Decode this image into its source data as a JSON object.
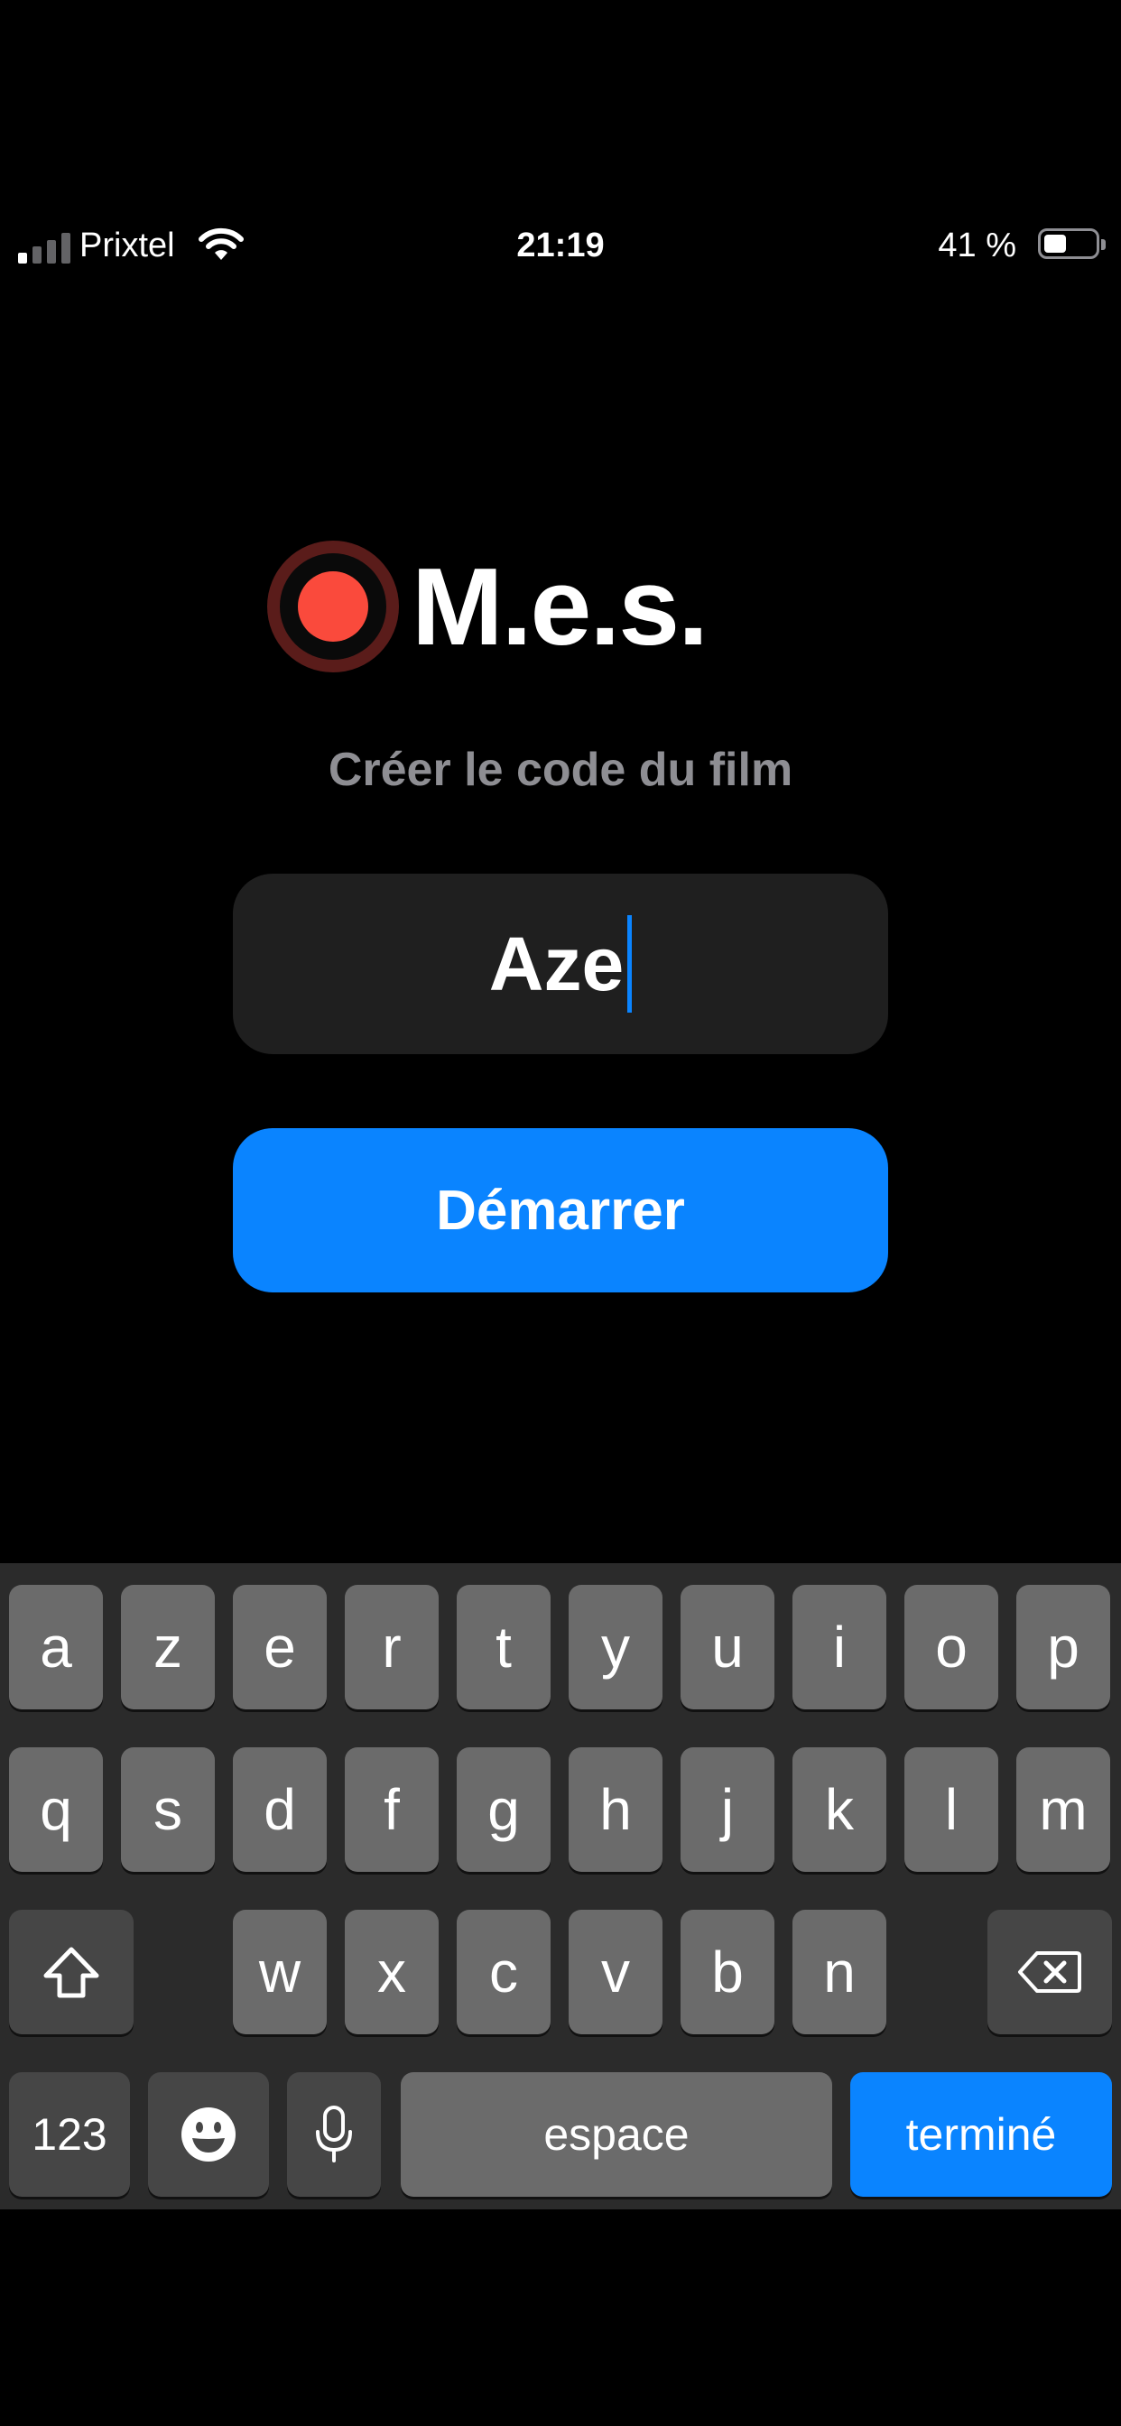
{
  "status_bar": {
    "carrier": "Prixtel",
    "time": "21:19",
    "battery": "41 %",
    "battery_level": 0.41
  },
  "app": {
    "logo_text": "M.e.s.",
    "subtitle": "Créer le code du film"
  },
  "code_field": {
    "value": "Aze"
  },
  "start_button": {
    "label": "Démarrer"
  },
  "keyboard": {
    "row1": [
      "a",
      "z",
      "e",
      "r",
      "t",
      "y",
      "u",
      "i",
      "o",
      "p"
    ],
    "row2": [
      "q",
      "s",
      "d",
      "f",
      "g",
      "h",
      "j",
      "k",
      "l",
      "m"
    ],
    "row3": [
      "w",
      "x",
      "c",
      "v",
      "b",
      "n"
    ],
    "numbers_label": "123",
    "space_label": "espace",
    "done_label": "terminé"
  },
  "colors": {
    "accent": "#0a84ff",
    "record_red": "#fa4a3c",
    "background": "#000000"
  },
  "icons": [
    "cellular-signal-icon",
    "wifi-icon",
    "battery-icon",
    "record-icon",
    "shift-icon",
    "backspace-icon",
    "emoji-icon",
    "microphone-icon"
  ]
}
